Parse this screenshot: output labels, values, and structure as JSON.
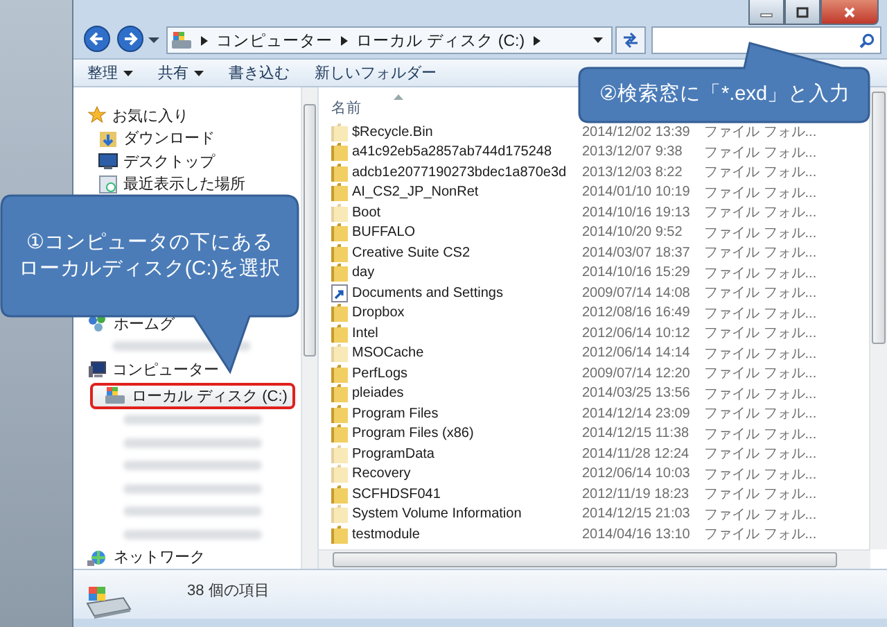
{
  "address": {
    "breadcrumb": [
      "コンピューター",
      "ローカル ディスク (C:)"
    ]
  },
  "toolbar": [
    {
      "label": "整理",
      "dropdown": true
    },
    {
      "label": "共有",
      "dropdown": true
    },
    {
      "label": "書き込む",
      "dropdown": false
    },
    {
      "label": "新しいフォルダー",
      "dropdown": false
    }
  ],
  "navigation": [
    {
      "label": "お気に入り",
      "kind": "favorites",
      "children": [
        {
          "label": "ダウンロード",
          "kind": "download"
        },
        {
          "label": "デスクトップ",
          "kind": "desktop"
        },
        {
          "label": "最近表示した場所",
          "kind": "recent"
        }
      ]
    },
    {
      "label": "ホームグ",
      "kind": "homegroup"
    },
    {
      "kind": "blurred"
    },
    {
      "label": "コンピューター",
      "kind": "computer",
      "children": [
        {
          "label": "ローカル ディスク (C:)",
          "kind": "drive",
          "selected": true
        },
        {
          "kind": "blurred",
          "selected": false
        },
        {
          "kind": "blurred",
          "selected": false
        },
        {
          "kind": "blurred",
          "selected": false
        },
        {
          "kind": "blurred",
          "selected": false
        },
        {
          "kind": "blurred",
          "selected": false
        },
        {
          "kind": "blurred",
          "selected": false
        }
      ]
    },
    {
      "label": "ネットワーク",
      "kind": "network"
    }
  ],
  "table": {
    "columns": [
      "名前"
    ],
    "rows": [
      {
        "name": "$Recycle.Bin",
        "date": "2014/12/02 13:39",
        "type": "ファイル フォル...",
        "kind": "hidden"
      },
      {
        "name": "a41c92eb5a2857ab744d175248",
        "date": "2013/12/07 9:38",
        "type": "ファイル フォル...",
        "kind": "folder"
      },
      {
        "name": "adcb1e2077190273bdec1a870e3d",
        "date": "2013/12/03 8:22",
        "type": "ファイル フォル...",
        "kind": "folder"
      },
      {
        "name": "AI_CS2_JP_NonRet",
        "date": "2014/01/10 10:19",
        "type": "ファイル フォル...",
        "kind": "folder"
      },
      {
        "name": "Boot",
        "date": "2014/10/16 19:13",
        "type": "ファイル フォル...",
        "kind": "hidden"
      },
      {
        "name": "BUFFALO",
        "date": "2014/10/20 9:52",
        "type": "ファイル フォル...",
        "kind": "folder"
      },
      {
        "name": "Creative Suite CS2",
        "date": "2014/03/07 18:37",
        "type": "ファイル フォル...",
        "kind": "folder"
      },
      {
        "name": "day",
        "date": "2014/10/16 15:29",
        "type": "ファイル フォル...",
        "kind": "folder"
      },
      {
        "name": "Documents and Settings",
        "date": "2009/07/14 14:08",
        "type": "ファイル フォル...",
        "kind": "shortcut"
      },
      {
        "name": "Dropbox",
        "date": "2012/08/16 16:49",
        "type": "ファイル フォル...",
        "kind": "folder"
      },
      {
        "name": "Intel",
        "date": "2012/06/14 10:12",
        "type": "ファイル フォル...",
        "kind": "folder"
      },
      {
        "name": "MSOCache",
        "date": "2012/06/14 14:14",
        "type": "ファイル フォル...",
        "kind": "hidden"
      },
      {
        "name": "PerfLogs",
        "date": "2009/07/14 12:20",
        "type": "ファイル フォル...",
        "kind": "folder"
      },
      {
        "name": "pleiades",
        "date": "2014/03/25 13:56",
        "type": "ファイル フォル...",
        "kind": "folder"
      },
      {
        "name": "Program Files",
        "date": "2014/12/14 23:09",
        "type": "ファイル フォル...",
        "kind": "folder"
      },
      {
        "name": "Program Files (x86)",
        "date": "2014/12/15 11:38",
        "type": "ファイル フォル...",
        "kind": "folder"
      },
      {
        "name": "ProgramData",
        "date": "2014/11/28 12:24",
        "type": "ファイル フォル...",
        "kind": "hidden"
      },
      {
        "name": "Recovery",
        "date": "2012/06/14 10:03",
        "type": "ファイル フォル...",
        "kind": "hidden"
      },
      {
        "name": "SCFHDSF041",
        "date": "2012/11/19 18:23",
        "type": "ファイル フォル...",
        "kind": "folder"
      },
      {
        "name": "System Volume Information",
        "date": "2014/12/15 21:03",
        "type": "ファイル フォル...",
        "kind": "hidden"
      },
      {
        "name": "testmodule",
        "date": "2014/04/16 13:10",
        "type": "ファイル フォル...",
        "kind": "folder"
      }
    ]
  },
  "status_bar": {
    "count": "38 個の項目"
  },
  "callouts": [
    {
      "kind": "down",
      "lines": [
        "①コンピュータの下にある",
        "ローカルディスク(C:)を選択"
      ]
    },
    {
      "kind": "up",
      "lines": [
        "②検索窓に「*.exd」と入力"
      ]
    }
  ]
}
